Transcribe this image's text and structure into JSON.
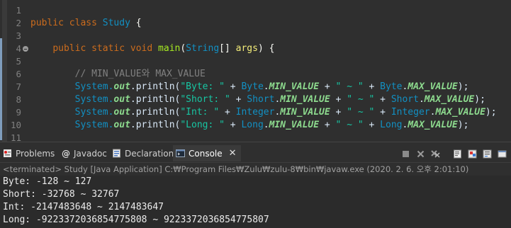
{
  "editor": {
    "line_numbers": [
      "1",
      "2",
      "3",
      "4",
      "5",
      "6",
      "7",
      "8",
      "9",
      "10",
      "11"
    ],
    "fold_marker": "⊖",
    "lines": {
      "l2": {
        "kw1": "public",
        "kw2": "class",
        "cls": "Study",
        "brace": " {"
      },
      "l4": {
        "kw1": "public",
        "kw2": "static",
        "kw3": "void",
        "fn": "main",
        "p1": "(",
        "typ": "String",
        "p2": "[] ",
        "var": "args",
        "p3": ") {"
      },
      "l6": {
        "comment": "// MIN_VALUE와 MAX_VALUE"
      },
      "l7": {
        "sys": "System.",
        "out": "out",
        "dot": ".println(",
        "str1": "\"Byte: \"",
        "plus1": " + ",
        "cls1": "Byte",
        "dot1": ".",
        "f1": "MIN_VALUE",
        "plus2": " + ",
        "str2": "\" ~ \"",
        "plus3": " + ",
        "cls2": "Byte",
        "dot2": ".",
        "f2": "MAX_VALUE",
        "end": ");"
      },
      "l8": {
        "sys": "System.",
        "out": "out",
        "dot": ".println(",
        "str1": "\"Short: \"",
        "plus1": " + ",
        "cls1": "Short",
        "dot1": ".",
        "f1": "MIN_VALUE",
        "plus2": " + ",
        "str2": "\" ~ \"",
        "plus3": " + ",
        "cls2": "Short",
        "dot2": ".",
        "f2": "MAX_VALUE",
        "end": ");"
      },
      "l9": {
        "sys": "System.",
        "out": "out",
        "dot": ".println(",
        "str1": "\"Int: \"",
        "plus1": " + ",
        "cls1": "Integer",
        "dot1": ".",
        "f1": "MIN_VALUE",
        "plus2": " + ",
        "str2": "\" ~ \"",
        "plus3": " + ",
        "cls2": "Integer",
        "dot2": ".",
        "f2": "MAX_VALUE",
        "end": ");"
      },
      "l10": {
        "sys": "System.",
        "out": "out",
        "dot": ".println(",
        "str1": "\"Long: \"",
        "plus1": " + ",
        "cls1": "Long",
        "dot1": ".",
        "f1": "MIN_VALUE",
        "plus2": " + ",
        "str2": "\" ~ \"",
        "plus3": " + ",
        "cls2": "Long",
        "dot2": ".",
        "f2": "MAX_VALUE",
        "end": ");"
      }
    }
  },
  "panel": {
    "tabs": [
      {
        "label": "Problems",
        "icon": "problems-icon"
      },
      {
        "label": "Javadoc",
        "icon": "javadoc-icon"
      },
      {
        "label": "Declaration",
        "icon": "declaration-icon"
      },
      {
        "label": "Console",
        "icon": "console-icon",
        "active": true
      }
    ],
    "close_glyph": "✕",
    "status": "<terminated> Study [Java Application] C:₩Program Files₩Zulu₩zulu-8₩bin₩javaw.exe (2020. 2. 6. 오후 2:01:10)",
    "output": [
      "Byte: -128 ~ 127",
      "Short: -32768 ~ 32767",
      "Int: -2147483648 ~ 2147483647",
      "Long: -9223372036854775808 ~ 9223372036854775807"
    ]
  }
}
